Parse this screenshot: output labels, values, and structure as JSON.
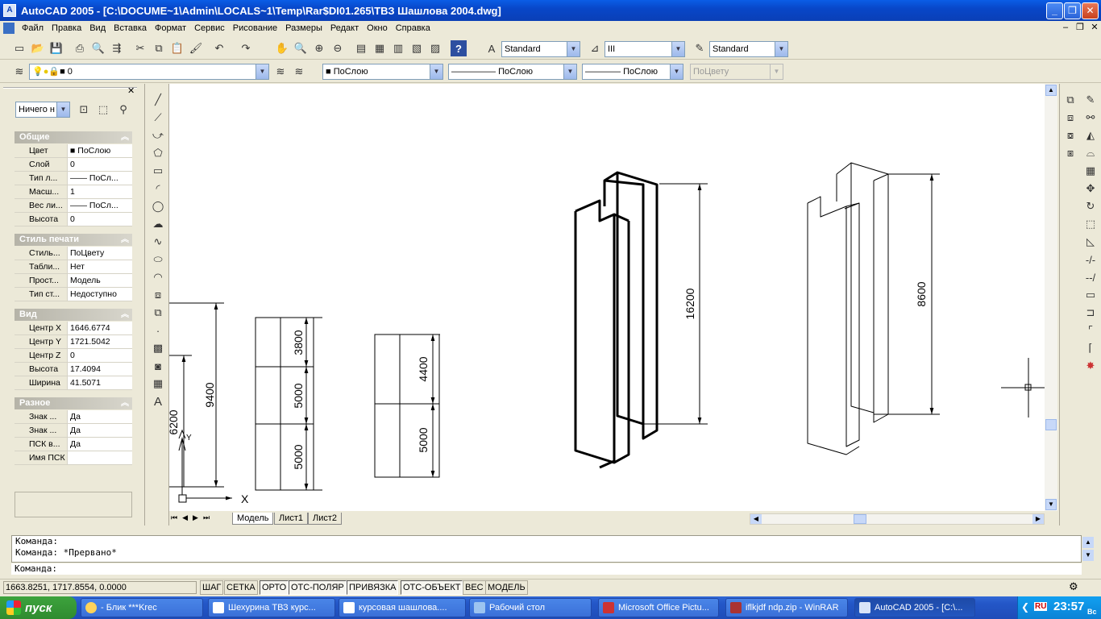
{
  "window": {
    "title": "AutoCAD 2005 - [C:\\DOCUME~1\\Admin\\LOCALS~1\\Temp\\Rar$DI01.265\\ТВЗ Шашлова 2004.dwg]",
    "minimize": "_",
    "restore": "❐",
    "close": "✕"
  },
  "menu": [
    "Файл",
    "Правка",
    "Вид",
    "Вставка",
    "Формат",
    "Сервис",
    "Рисование",
    "Размеры",
    "Редакт",
    "Окно",
    "Справка"
  ],
  "toolbar": {
    "text_style": "Standard",
    "dim_style": "III",
    "table_style": "Standard",
    "layer": "0",
    "color": "ПоСлою",
    "linetype": "ПоСлою",
    "lineweight": "ПоСлою",
    "plotstyle": "ПоЦвету"
  },
  "props": {
    "selection": "Ничего н",
    "close": "✕",
    "sections": [
      {
        "title": "Общие",
        "rows": [
          {
            "name": "Цвет",
            "value": "ПоСлою"
          },
          {
            "name": "Слой",
            "value": "0"
          },
          {
            "name": "Тип л...",
            "value": "—— ПоСл..."
          },
          {
            "name": "Масш...",
            "value": "1"
          },
          {
            "name": "Вес ли...",
            "value": "—— ПоСл..."
          },
          {
            "name": "Высота",
            "value": "0"
          }
        ]
      },
      {
        "title": "Стиль печати",
        "rows": [
          {
            "name": "Стиль...",
            "value": "ПоЦвету"
          },
          {
            "name": "Табли...",
            "value": "Нет"
          },
          {
            "name": "Прост...",
            "value": "Модель"
          },
          {
            "name": "Тип ст...",
            "value": "Недоступно"
          }
        ]
      },
      {
        "title": "Вид",
        "rows": [
          {
            "name": "Центр X",
            "value": "1646.6774"
          },
          {
            "name": "Центр Y",
            "value": "1721.5042"
          },
          {
            "name": "Центр Z",
            "value": "0"
          },
          {
            "name": "Высота",
            "value": "17.4094"
          },
          {
            "name": "Ширина",
            "value": "41.5071"
          }
        ]
      },
      {
        "title": "Разное",
        "rows": [
          {
            "name": "Знак ...",
            "value": "Да"
          },
          {
            "name": "Знак ...",
            "value": "Да"
          },
          {
            "name": "ПСК в...",
            "value": "Да"
          },
          {
            "name": "Имя ПСК",
            "value": ""
          }
        ]
      }
    ]
  },
  "drawing": {
    "dims": {
      "d9400": "9400",
      "d6200": "6200",
      "d3800": "3800",
      "d5000a": "5000",
      "d5000b": "5000",
      "d4400": "4400",
      "d5000c": "5000",
      "d16200": "16200",
      "d8600": "8600"
    },
    "ucs_x": "X",
    "ucs_y": "Y"
  },
  "tabs": [
    "Модель",
    "Лист1",
    "Лист2"
  ],
  "command": {
    "lines": [
      "Команда:",
      "Команда: *Прервано*"
    ],
    "prompt": "Команда:"
  },
  "status": {
    "coords": "1663.8251, 1717.8554, 0.0000",
    "buttons": [
      "ШАГ",
      "СЕТКА",
      "ОРТО",
      "ОТС-ПОЛЯР",
      "ПРИВЯЗКА",
      "ОТС-ОБЪЕКТ",
      "ВЕС",
      "МОДЕЛЬ"
    ]
  },
  "taskbar": {
    "start": "пуск",
    "tasks": [
      "- Блик ***Krec",
      "Шехурина ТВЗ курс...",
      "курсовая шашлова....",
      "Рабочий стол",
      "Microsoft Office Pictu...",
      "iflkjdf ndp.zip - WinRAR",
      "AutoCAD 2005 - [C:\\..."
    ],
    "lang": "RU",
    "time": "23:57",
    "day": "Вс"
  }
}
